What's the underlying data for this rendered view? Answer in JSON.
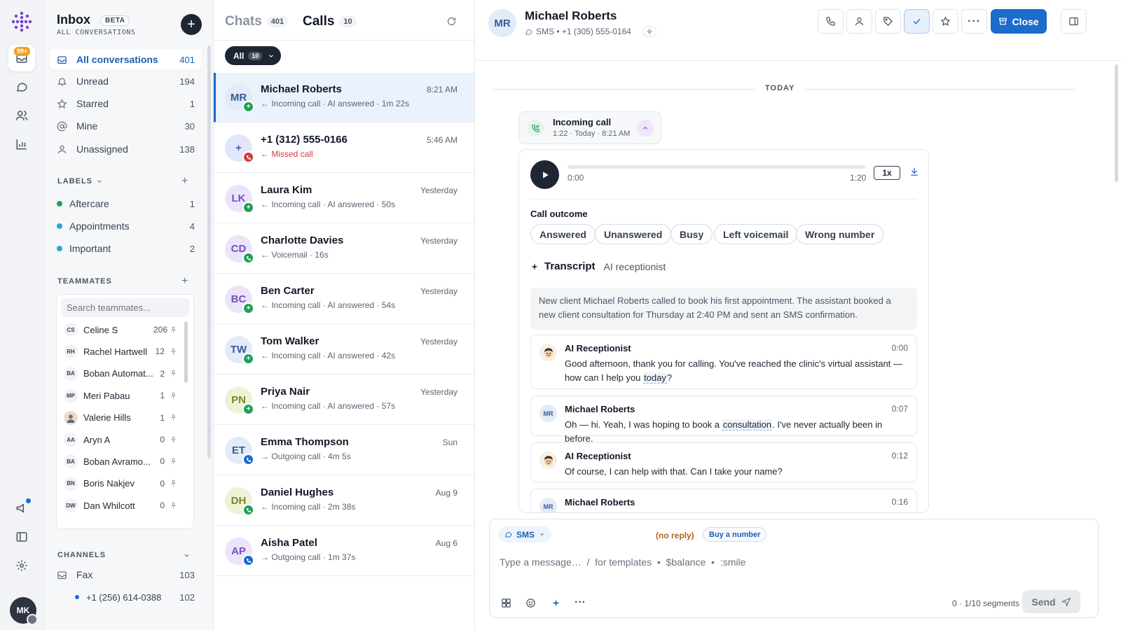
{
  "rail": {
    "badge": "99+",
    "avatar_initials": "MK"
  },
  "sidebar": {
    "title": "Inbox",
    "beta": "BETA",
    "subtitle": "ALL CONVERSATIONS",
    "nav": [
      {
        "label": "All conversations",
        "count": "401"
      },
      {
        "label": "Unread",
        "count": "194"
      },
      {
        "label": "Starred",
        "count": "1"
      },
      {
        "label": "Mine",
        "count": "30"
      },
      {
        "label": "Unassigned",
        "count": "138"
      }
    ],
    "labels_heading": "LABELS",
    "labels": [
      {
        "label": "Aftercare",
        "count": "1",
        "color": "#22a05a"
      },
      {
        "label": "Appointments",
        "count": "4",
        "color": "#2aa7d8"
      },
      {
        "label": "Important",
        "count": "2",
        "color": "#2aa7d8"
      }
    ],
    "teammates_heading": "TEAMMATES",
    "teammates_search_placeholder": "Search teammates...",
    "teammates": [
      {
        "initials": "CS",
        "name": "Celine S",
        "count": "206"
      },
      {
        "initials": "RH",
        "name": "Rachel Hartwell",
        "count": "12"
      },
      {
        "initials": "BA",
        "name": "Boban Automat...",
        "count": "2"
      },
      {
        "initials": "MP",
        "name": "Meri Pabau",
        "count": "1"
      },
      {
        "initials": "",
        "name": "Valerie Hills",
        "count": "1"
      },
      {
        "initials": "AA",
        "name": "Aryn A",
        "count": "0"
      },
      {
        "initials": "BA",
        "name": "Boban Avramo...",
        "count": "0"
      },
      {
        "initials": "BN",
        "name": "Boris Nakjev",
        "count": "0"
      },
      {
        "initials": "DW",
        "name": "Dan Whilcott",
        "count": "0"
      }
    ],
    "channels_heading": "CHANNELS",
    "channels": [
      {
        "label": "Fax",
        "count": "103"
      },
      {
        "label": "+1 (256) 614-0388",
        "count": "102"
      }
    ]
  },
  "list": {
    "tabs": [
      {
        "label": "Chats",
        "count": "401"
      },
      {
        "label": "Calls",
        "count": "10"
      }
    ],
    "filter": {
      "label": "All",
      "count": "10"
    },
    "rows": [
      {
        "initials": "MR",
        "name": "Michael Roberts",
        "sub": "Incoming call · AI answered · 1m 22s",
        "time": "8:21 AM",
        "dir": "in",
        "badge": "ai",
        "av_bg": "#e2ebf7",
        "av_fg": "#345d9a"
      },
      {
        "initials": "+",
        "name": "+1 (312) 555-0166",
        "sub": "Missed call",
        "time": "5:46 AM",
        "dir": "in",
        "badge": "missed",
        "av_bg": "#e2e6fb",
        "av_fg": "#4a55b8"
      },
      {
        "initials": "LK",
        "name": "Laura Kim",
        "sub": "Incoming call · AI answered · 50s",
        "time": "Yesterday",
        "dir": "in",
        "badge": "ai",
        "av_bg": "#ece4f9",
        "av_fg": "#7a4fc0"
      },
      {
        "initials": "CD",
        "name": "Charlotte Davies",
        "sub": "Voicemail · 16s",
        "time": "Yesterday",
        "dir": "in",
        "badge": "phone",
        "av_bg": "#ece4f9",
        "av_fg": "#7a4fc0"
      },
      {
        "initials": "BC",
        "name": "Ben Carter",
        "sub": "Incoming call · AI answered · 54s",
        "time": "Yesterday",
        "dir": "in",
        "badge": "ai",
        "av_bg": "#ece4f9",
        "av_fg": "#7a4fc0"
      },
      {
        "initials": "TW",
        "name": "Tom Walker",
        "sub": "Incoming call · AI answered · 42s",
        "time": "Yesterday",
        "dir": "in",
        "badge": "ai",
        "av_bg": "#e2ebf7",
        "av_fg": "#345d9a"
      },
      {
        "initials": "PN",
        "name": "Priya Nair",
        "sub": "Incoming call · AI answered · 57s",
        "time": "Yesterday",
        "dir": "in",
        "badge": "ai",
        "av_bg": "#eef3d8",
        "av_fg": "#7a8a1e"
      },
      {
        "initials": "ET",
        "name": "Emma Thompson",
        "sub": "Outgoing call · 4m 5s",
        "time": "Sun",
        "dir": "out",
        "badge": "out",
        "av_bg": "#e2ebf7",
        "av_fg": "#345d9a"
      },
      {
        "initials": "DH",
        "name": "Daniel Hughes",
        "sub": "Incoming call · 2m 38s",
        "time": "Aug 9",
        "dir": "in",
        "badge": "phone",
        "av_bg": "#eef3d8",
        "av_fg": "#7a8a1e"
      },
      {
        "initials": "AP",
        "name": "Aisha Patel",
        "sub": "Outgoing call · 1m 37s",
        "time": "Aug 6",
        "dir": "out",
        "badge": "out",
        "av_bg": "#ece4f9",
        "av_fg": "#7a4fc0"
      }
    ]
  },
  "main": {
    "contact": {
      "initials": "MR",
      "name": "Michael Roberts",
      "sub": "SMS • +1 (305) 555-0164"
    },
    "close_label": "Close",
    "today_label": "TODAY",
    "call_title": "Incoming call",
    "call_meta": "1:22 · Today · 8:21 AM",
    "player": {
      "elapsed": "0:00",
      "total": "1:20",
      "speed": "1x",
      "progress": 0
    },
    "outcome_heading": "Call outcome",
    "outcomes": [
      "Answered",
      "Unanswered",
      "Busy",
      "Left voicemail",
      "Wrong number"
    ],
    "transcript_heading": "Transcript",
    "transcript_source": "AI receptionist",
    "summary": "New client Michael Roberts called to book his first appointment. The assistant booked a new client consultation for Thursday at 2:40 PM and sent an SMS confirmation.",
    "messages": [
      {
        "who": "AI Receptionist",
        "time": "0:00",
        "pre": "Good afternoon, thank you for calling. You've reached the clinic's virtual assistant — how can I help you ",
        "hl": "today",
        "post": "?"
      },
      {
        "who": "Michael Roberts",
        "time": "0:07",
        "pre": "Oh — hi. Yeah, I was hoping to book a ",
        "hl": "consultation",
        "post": ". I've never actually been in before."
      },
      {
        "who": "AI Receptionist",
        "time": "0:12",
        "pre": "Of course, I can help with that. Can I take your name?",
        "hl": "",
        "post": ""
      },
      {
        "who": "Michael Roberts",
        "time": "0:16",
        "pre": "",
        "hl": "",
        "post": ""
      }
    ],
    "composer": {
      "channel": "SMS",
      "no_reply": "(no reply)",
      "buy_number": "Buy a number",
      "placeholder": "Type a message…  /  for templates  •  $balance  •  :smile",
      "segments": "0 · 1/10 segments",
      "send": "Send"
    }
  }
}
